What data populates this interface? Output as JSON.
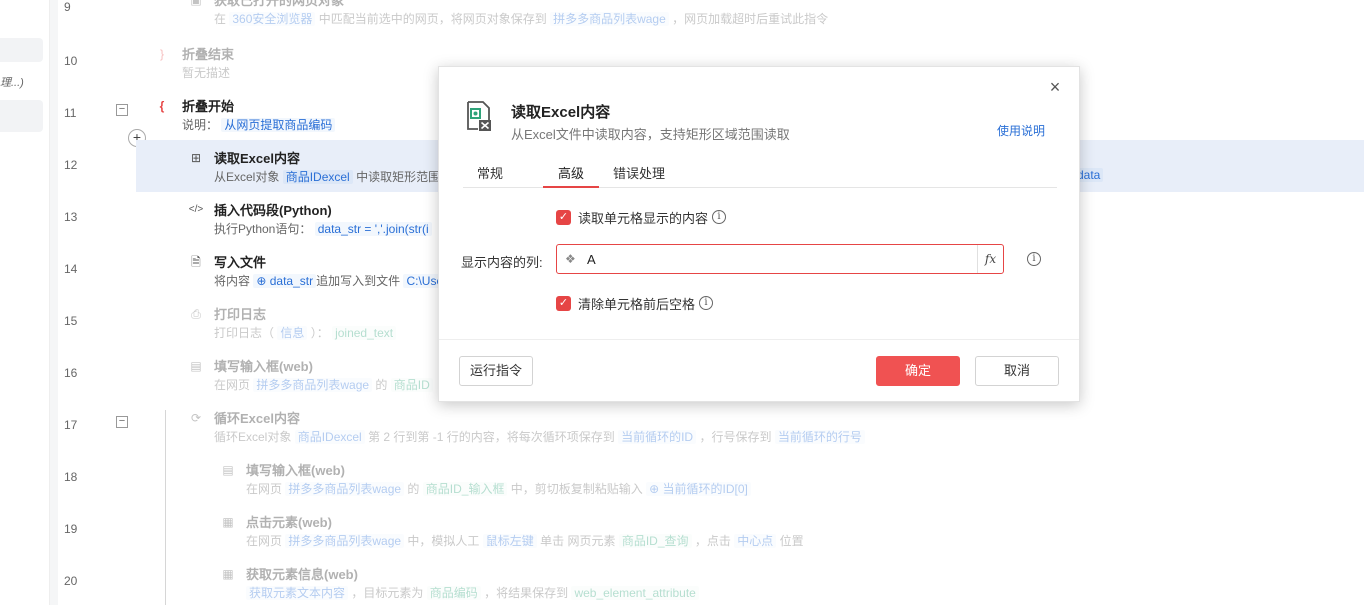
{
  "sidebar": {
    "fragment": "理...)"
  },
  "rows": [
    {
      "num": "9",
      "title": "获取已打开的网页对象",
      "desc_prefix": "在",
      "tag1": "360安全浏览器",
      "desc_mid": "中匹配当前选中的网页，将网页对象保存到",
      "tag2": "拼多多商品列表wage",
      "desc_suffix": "，网页加载超时后重试此指令"
    },
    {
      "num": "10",
      "title": "折叠结束",
      "desc": "暂无描述"
    },
    {
      "num": "11",
      "title": "折叠开始",
      "desc_prefix": "说明：",
      "tag1": "从网页提取商品编码"
    },
    {
      "num": "12",
      "title": "读取Excel内容",
      "desc_prefix": "从Excel对象",
      "tag1": "商品IDexcel",
      "desc_mid": "中读取矩形范围",
      "tag_right": "data"
    },
    {
      "num": "13",
      "title": "插入代码段(Python)",
      "desc_prefix": "执行Python语句：",
      "code": "data_str = ','.join(str(i"
    },
    {
      "num": "14",
      "title": "写入文件",
      "desc_prefix": "将内容",
      "tag1": "data_str",
      "desc_mid": "追加写入到文件",
      "tag2": "C:\\Use"
    },
    {
      "num": "15",
      "title": "打印日志",
      "desc_prefix": "打印日志（",
      "tag1": "信息",
      "desc_mid": "）：",
      "tag2": "joined_text"
    },
    {
      "num": "16",
      "title": "填写输入框(web)",
      "desc_prefix": "在网页",
      "tag1": "拼多多商品列表wage",
      "desc_mid": "的",
      "tag2": "商品ID"
    },
    {
      "num": "17",
      "title": "循环Excel内容",
      "desc_prefix": "循环Excel对象",
      "tag1": "商品IDexcel",
      "desc_mid": "第 2 行到第 -1 行的内容，将每次循环项保存到",
      "tag2": "当前循环的ID",
      "desc_mid2": "，行号保存到",
      "tag3": "当前循环的行号"
    },
    {
      "num": "18",
      "title": "填写输入框(web)",
      "desc_prefix": "在网页",
      "tag1": "拼多多商品列表wage",
      "desc_mid": "的",
      "tag2": "商品ID_输入框",
      "desc_mid2": "中，剪切板复制粘贴输入",
      "tag3": "当前循环的ID[0]"
    },
    {
      "num": "19",
      "title": "点击元素(web)",
      "desc_prefix": "在网页",
      "tag1": "拼多多商品列表wage",
      "desc_mid": "中，模拟人工",
      "tag2": "鼠标左键",
      "desc_mid2": "单击",
      "desc_mid3": "网页元素",
      "tag3": "商品ID_查询",
      "desc_mid4": "，点击",
      "tag4": "中心点",
      "desc_suffix": "位置"
    },
    {
      "num": "20",
      "title": "获取元素信息(web)",
      "desc_prefix": "",
      "tag1": "获取元素文本内容",
      "desc_mid": "，目标元素为",
      "tag2": "商品编码",
      "desc_mid2": "，将结果保存到",
      "tag3": "web_element_attribute"
    }
  ],
  "dialog": {
    "title": "读取Excel内容",
    "subtitle": "从Excel文件中读取内容，支持矩形区域范围读取",
    "help": "使用说明",
    "tabs": [
      "常规",
      "高级",
      "错误处理"
    ],
    "active_tab": "高级",
    "opt_display": "读取单元格显示的内容",
    "field_label": "显示内容的列:",
    "field_value": "A",
    "opt_trim": "清除单元格前后空格",
    "btn_run": "运行指令",
    "btn_ok": "确定",
    "btn_cancel": "取消"
  },
  "colors": {
    "accent": "#e64545",
    "link": "#2a6fd6",
    "selected_row": "#e8eef9"
  }
}
